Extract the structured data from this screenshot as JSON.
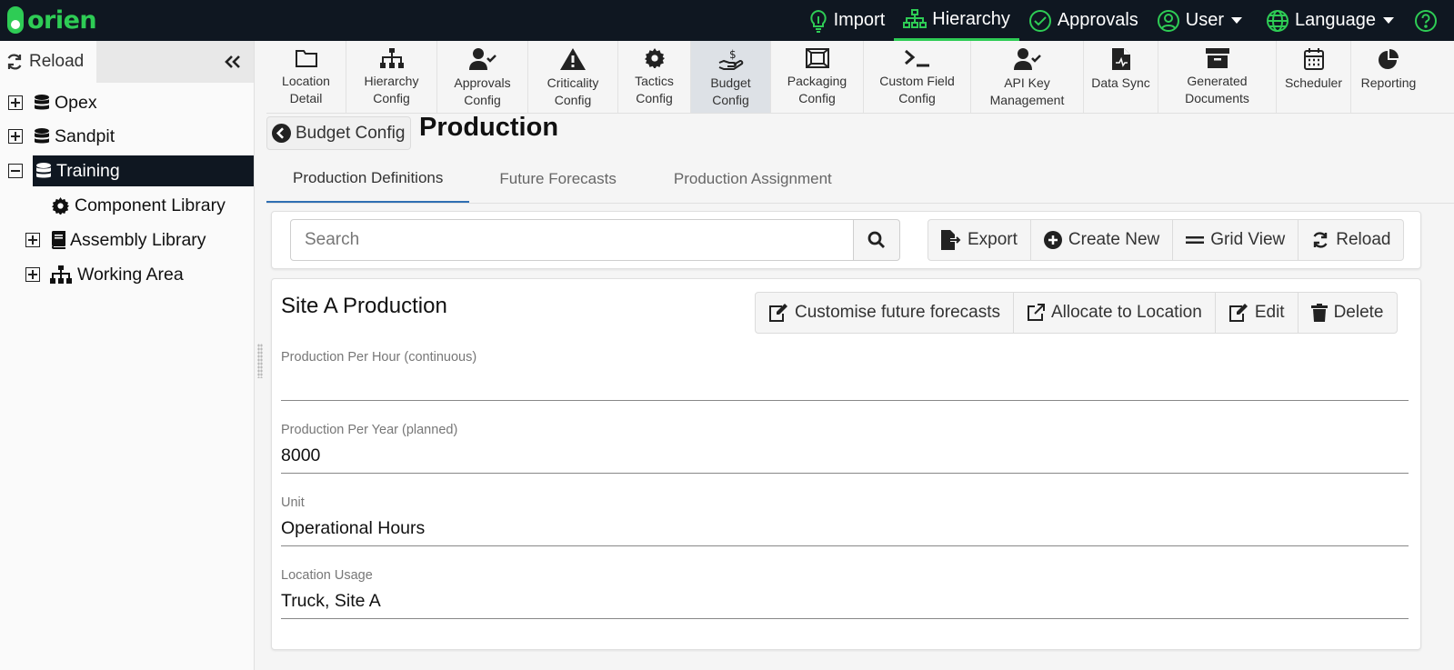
{
  "app": {
    "logo_text": "orien",
    "brand_color": "#2ecc55"
  },
  "topnav": {
    "items": [
      {
        "label": "Import",
        "icon": "lightbulb-icon"
      },
      {
        "label": "Hierarchy",
        "icon": "sitemap-icon",
        "active": true
      },
      {
        "label": "Approvals",
        "icon": "check-circle-icon"
      },
      {
        "label": "User",
        "icon": "user-circle-icon",
        "dropdown": true
      },
      {
        "label": "Language",
        "icon": "globe-icon",
        "dropdown": true
      }
    ],
    "help_icon": "question-circle-icon"
  },
  "sidebar": {
    "reload_label": "Reload",
    "tree": [
      {
        "label": "Opex",
        "expanded": false,
        "icon": "database-icon"
      },
      {
        "label": "Sandpit",
        "expanded": false,
        "icon": "database-icon"
      },
      {
        "label": "Training",
        "expanded": true,
        "selected": true,
        "icon": "database-icon"
      },
      {
        "label": "Component Library",
        "icon": "gear-icon"
      },
      {
        "label": "Assembly Library",
        "expanded": false,
        "icon": "book-icon"
      },
      {
        "label": "Working Area",
        "expanded": false,
        "icon": "sitemap-icon"
      }
    ]
  },
  "toolbar": {
    "items": [
      {
        "line1": "Location",
        "line2": "Detail",
        "icon": "folder-icon"
      },
      {
        "line1": "Hierarchy",
        "line2": "Config",
        "icon": "sitemap-icon"
      },
      {
        "line1": "Approvals",
        "line2": "Config",
        "icon": "user-check-icon"
      },
      {
        "line1": "Criticality",
        "line2": "Config",
        "icon": "warning-icon"
      },
      {
        "line1": "Tactics",
        "line2": "Config",
        "icon": "gear-icon"
      },
      {
        "line1": "Budget",
        "line2": "Config",
        "icon": "hand-dollar-icon",
        "active": true
      },
      {
        "line1": "Packaging",
        "line2": "Config",
        "icon": "packaging-icon"
      },
      {
        "line1": "Custom Field",
        "line2": "Config",
        "icon": "terminal-icon"
      },
      {
        "line1": "API Key",
        "line2": "Management",
        "icon": "user-check-icon"
      },
      {
        "line1": "Data Sync",
        "line2": "",
        "icon": "file-sync-icon"
      },
      {
        "line1": "Generated",
        "line2": "Documents",
        "icon": "archive-icon"
      },
      {
        "line1": "Scheduler",
        "line2": "",
        "icon": "calendar-icon"
      },
      {
        "line1": "Reporting",
        "line2": "",
        "icon": "pie-chart-icon"
      }
    ]
  },
  "header": {
    "back_label": "Budget Config",
    "title": "Production"
  },
  "tabs": [
    {
      "label": "Production Definitions",
      "active": true
    },
    {
      "label": "Future Forecasts"
    },
    {
      "label": "Production Assignment"
    }
  ],
  "search": {
    "placeholder": "Search",
    "value": "",
    "buttons": {
      "export": "Export",
      "create_new": "Create New",
      "grid_view": "Grid View",
      "reload": "Reload"
    }
  },
  "detail": {
    "title": "Site A Production",
    "actions": {
      "customise": "Customise future forecasts",
      "allocate": "Allocate to Location",
      "edit": "Edit",
      "delete": "Delete"
    },
    "fields": [
      {
        "label": "Production Per Hour (continuous)",
        "value": ""
      },
      {
        "label": "Production Per Year (planned)",
        "value": "8000"
      },
      {
        "label": "Unit",
        "value": "Operational Hours"
      },
      {
        "label": "Location Usage",
        "value": "Truck, Site A"
      }
    ]
  }
}
